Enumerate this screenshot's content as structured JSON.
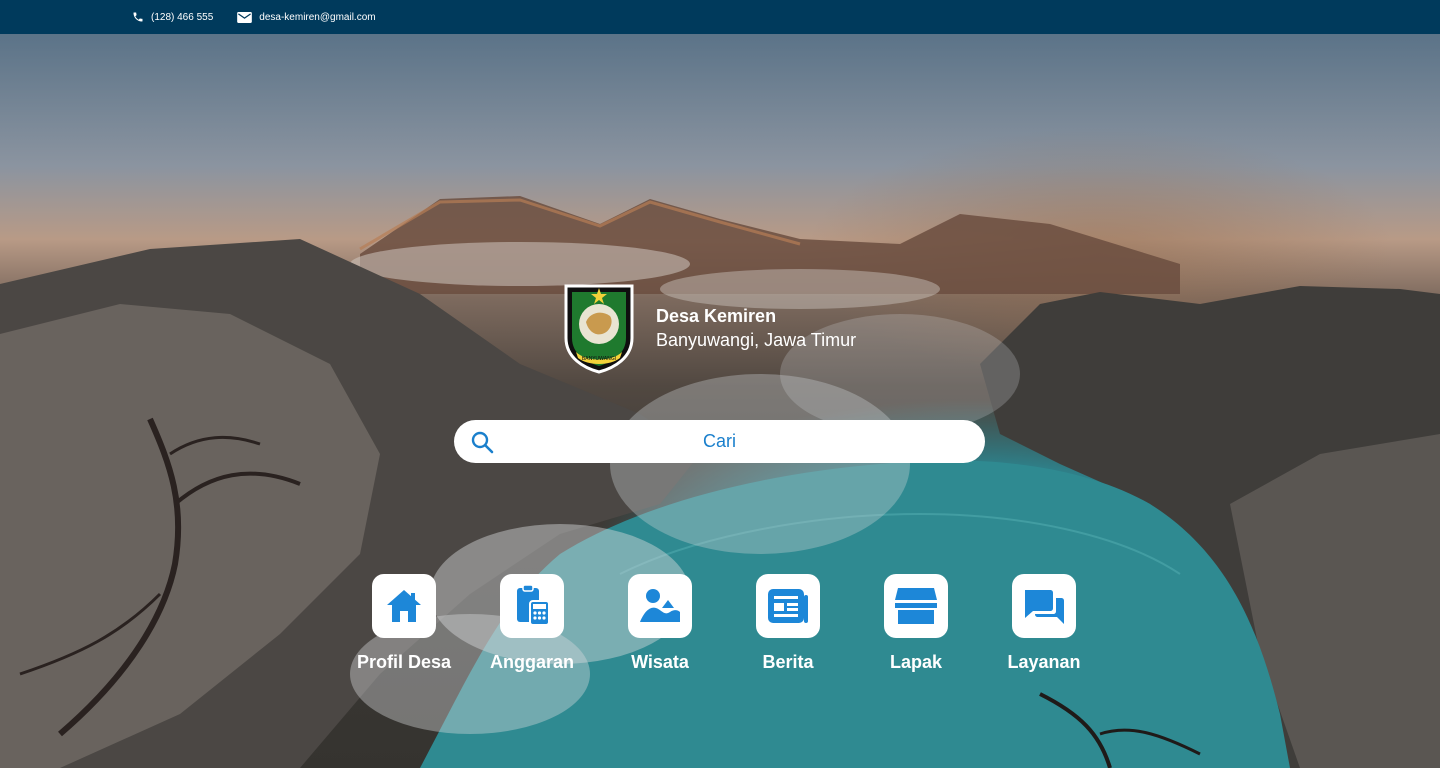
{
  "topbar": {
    "phone": "(128) 466 555",
    "email": "desa-kemiren@gmail.com",
    "phone_icon": "phone-icon",
    "email_icon": "envelope-icon"
  },
  "brand": {
    "name": "Desa Kemiren",
    "region": "Banyuwangi, Jawa Timur",
    "logo_label": "BANYUWANGI"
  },
  "search": {
    "placeholder": "Cari",
    "icon": "search-icon"
  },
  "menu": {
    "items": [
      {
        "label": "Profil Desa",
        "icon": "home-icon"
      },
      {
        "label": "Anggaran",
        "icon": "budget-calculator-icon"
      },
      {
        "label": "Wisata",
        "icon": "tourism-landscape-icon"
      },
      {
        "label": "Berita",
        "icon": "newspaper-icon"
      },
      {
        "label": "Lapak",
        "icon": "store-icon"
      },
      {
        "label": "Layanan",
        "icon": "chat-icon"
      }
    ]
  },
  "colors": {
    "topbar": "#003a5c",
    "accent": "#1a7fcc",
    "icon_blue": "#1d87d8",
    "tile_bg": "#ffffff"
  }
}
